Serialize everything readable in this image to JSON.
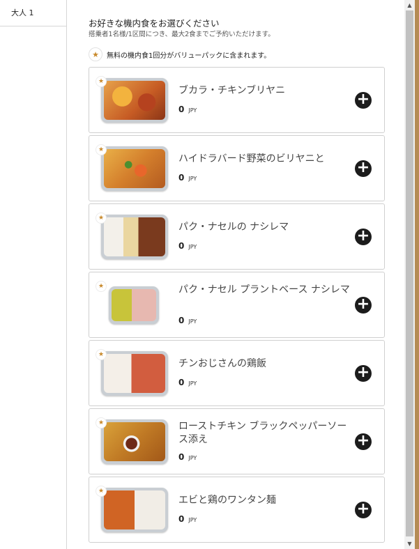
{
  "passenger_tab": {
    "label": "大人 1"
  },
  "header": {
    "title": "お好きな機内食をお選びください",
    "subtitle": "搭乗者1名様/1区間につき、最大2食までご予約いただけます。",
    "note": "無料の機内食1回分がバリューパックに含まれます。"
  },
  "icons": {
    "star": "★",
    "add": "+"
  },
  "colors": {
    "star": "#c8892b",
    "add_button": "#1c1c1c"
  },
  "meals": [
    {
      "name": "ブカラ・チキンブリヤニ",
      "price": "0",
      "currency": "JPY"
    },
    {
      "name": "ハイドラバード野菜のビリヤニと",
      "price": "0",
      "currency": "JPY"
    },
    {
      "name": "パク・ナセルの ナシレマ",
      "price": "0",
      "currency": "JPY"
    },
    {
      "name": "パク・ナセル プラントベース ナシレマ",
      "price": "0",
      "currency": "JPY"
    },
    {
      "name": "チンおじさんの鶏飯",
      "price": "0",
      "currency": "JPY"
    },
    {
      "name": "ローストチキン ブラックペッパーソース添え",
      "price": "0",
      "currency": "JPY"
    },
    {
      "name": "エビと鶏のワンタン麺",
      "price": "0",
      "currency": "JPY"
    }
  ],
  "scrollbar": {
    "up": "▲",
    "down": "▼"
  }
}
